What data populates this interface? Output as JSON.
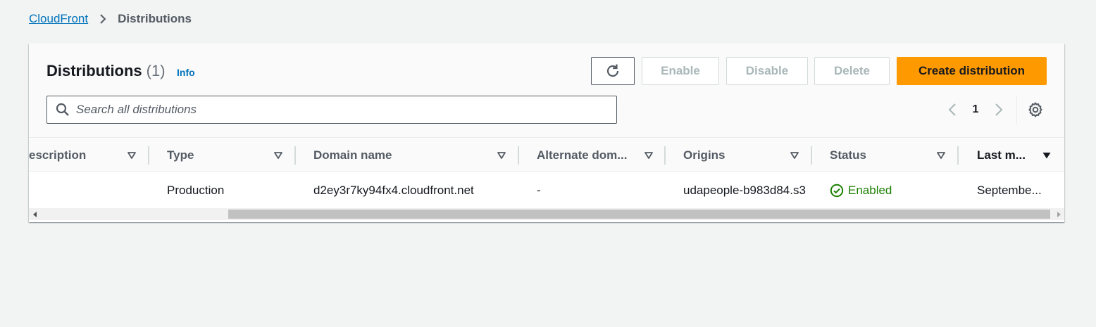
{
  "breadcrumb": {
    "root": "CloudFront",
    "current": "Distributions"
  },
  "header": {
    "title": "Distributions",
    "count": "(1)",
    "info": "Info"
  },
  "actions": {
    "refresh_icon": "refresh-icon",
    "enable": "Enable",
    "disable": "Disable",
    "delete": "Delete",
    "create": "Create distribution"
  },
  "search": {
    "placeholder": "Search all distributions",
    "value": ""
  },
  "pagination": {
    "current_page": "1"
  },
  "table": {
    "columns": [
      "escription",
      "Type",
      "Domain name",
      "Alternate dom...",
      "Origins",
      "Status",
      "Last m..."
    ],
    "rows": [
      {
        "description": "",
        "type": "Production",
        "domain_name": "d2ey3r7ky94fx4.cloudfront.net",
        "alternate_domain": "-",
        "origins": "udapeople-b983d84.s3",
        "status": "Enabled",
        "last_modified": "Septembe..."
      }
    ]
  },
  "colors": {
    "link": "#0073bb",
    "primary_button": "#ff9900",
    "success": "#1d8102",
    "background": "#f2f3f3"
  }
}
